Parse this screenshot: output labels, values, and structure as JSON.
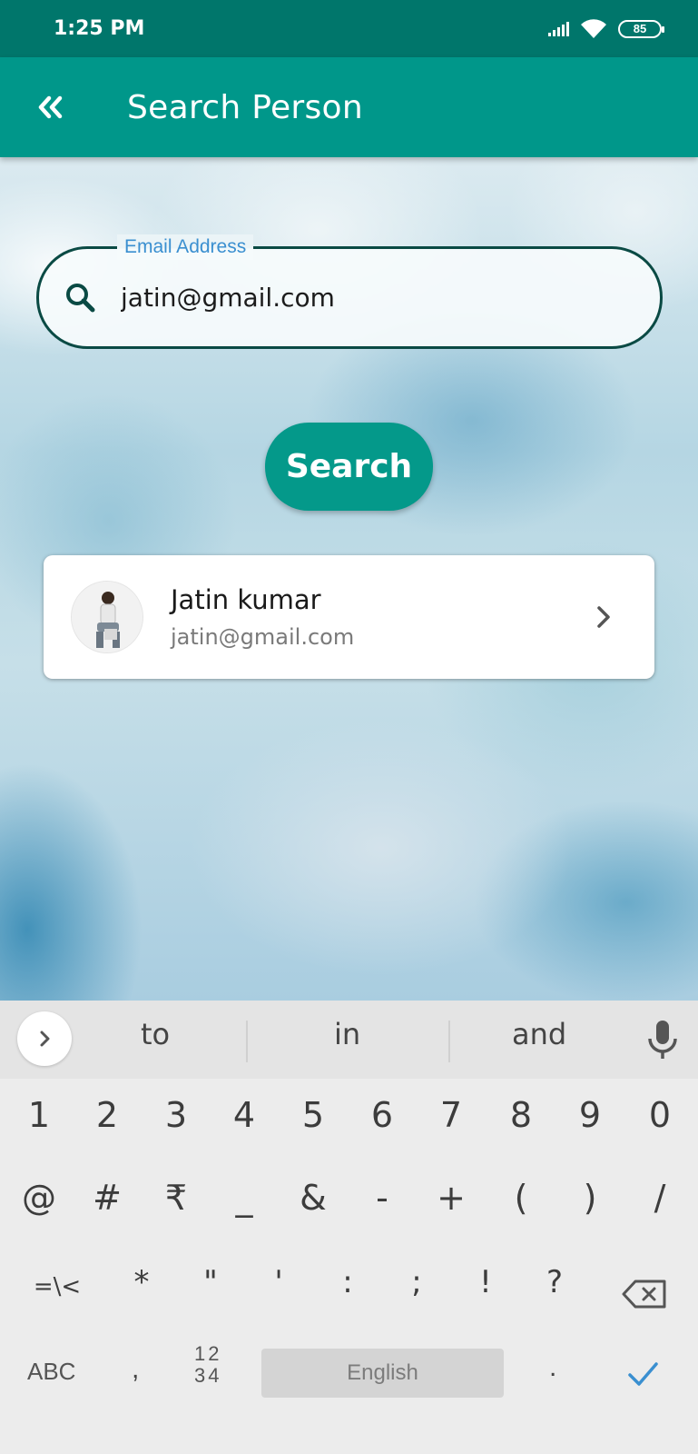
{
  "status_bar": {
    "time": "1:25 PM",
    "battery": "85"
  },
  "app_bar": {
    "title": "Search Person",
    "back_icon": "double-chevron-left-icon"
  },
  "email_field": {
    "label": "Email Address",
    "value": "jatin@gmail.com",
    "icon": "search-icon"
  },
  "search_button": {
    "label": "Search"
  },
  "result": {
    "name": "Jatin kumar",
    "email": "jatin@gmail.com",
    "icon": "chevron-right-icon"
  },
  "keyboard": {
    "suggestions": [
      "to",
      "in",
      "and"
    ],
    "row1": [
      "1",
      "2",
      "3",
      "4",
      "5",
      "6",
      "7",
      "8",
      "9",
      "0"
    ],
    "row2": [
      "@",
      "#",
      "₹",
      "_",
      "&",
      "-",
      "+",
      "(",
      ")",
      "/"
    ],
    "row3": [
      "=\\<",
      "*",
      "\"",
      "'",
      ":",
      ";",
      "!",
      "?"
    ],
    "abc_label": "ABC",
    "comma": ",",
    "num_top": "12",
    "num_bottom": "34",
    "space_label": "English",
    "period": "."
  },
  "colors": {
    "status_bar": "#00766b",
    "app_bar": "#00978a",
    "accent": "#04998a",
    "field_border": "#0a4a44",
    "label": "#3a8fd0",
    "done_check": "#3a8fd0"
  }
}
